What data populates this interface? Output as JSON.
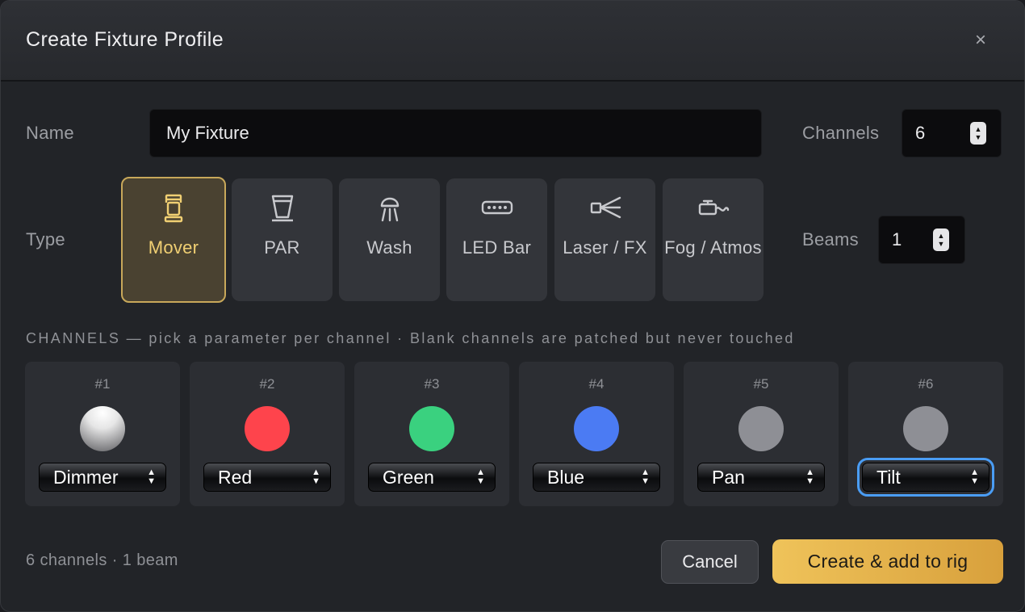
{
  "dialog": {
    "title": "Create Fixture Profile",
    "close_glyph": "×"
  },
  "form": {
    "name_label": "Name",
    "name_value": "My Fixture",
    "channels_label": "Channels",
    "channels_value": "6",
    "type_label": "Type",
    "beams_label": "Beams",
    "beams_value": "1"
  },
  "types": [
    {
      "label": "Mover",
      "icon": "mover-icon",
      "selected": true
    },
    {
      "label": "PAR",
      "icon": "par-icon",
      "selected": false
    },
    {
      "label": "Wash",
      "icon": "wash-icon",
      "selected": false
    },
    {
      "label": "LED Bar",
      "icon": "led-bar-icon",
      "selected": false
    },
    {
      "label": "Laser / FX",
      "icon": "laser-icon",
      "selected": false
    },
    {
      "label": "Fog / Atmos",
      "icon": "fog-icon",
      "selected": false
    }
  ],
  "channels_section": {
    "heading": "CHANNELS — pick a parameter per channel · Blank channels are patched but never touched"
  },
  "channels": [
    {
      "num": "#1",
      "param": "Dimmer",
      "color": "gradient-white"
    },
    {
      "num": "#2",
      "param": "Red",
      "color": "#fe444c"
    },
    {
      "num": "#3",
      "param": "Green",
      "color": "#3ad17f"
    },
    {
      "num": "#4",
      "param": "Blue",
      "color": "#4b7bf3"
    },
    {
      "num": "#5",
      "param": "Pan",
      "color": "#8e8f95"
    },
    {
      "num": "#6",
      "param": "Tilt",
      "color": "#8e8f95"
    }
  ],
  "footer": {
    "summary": "6 channels · 1 beam",
    "cancel_label": "Cancel",
    "create_label": "Create & add to rig"
  },
  "colors": {
    "accent": "#e8b64e",
    "focus": "#4a9df5"
  }
}
